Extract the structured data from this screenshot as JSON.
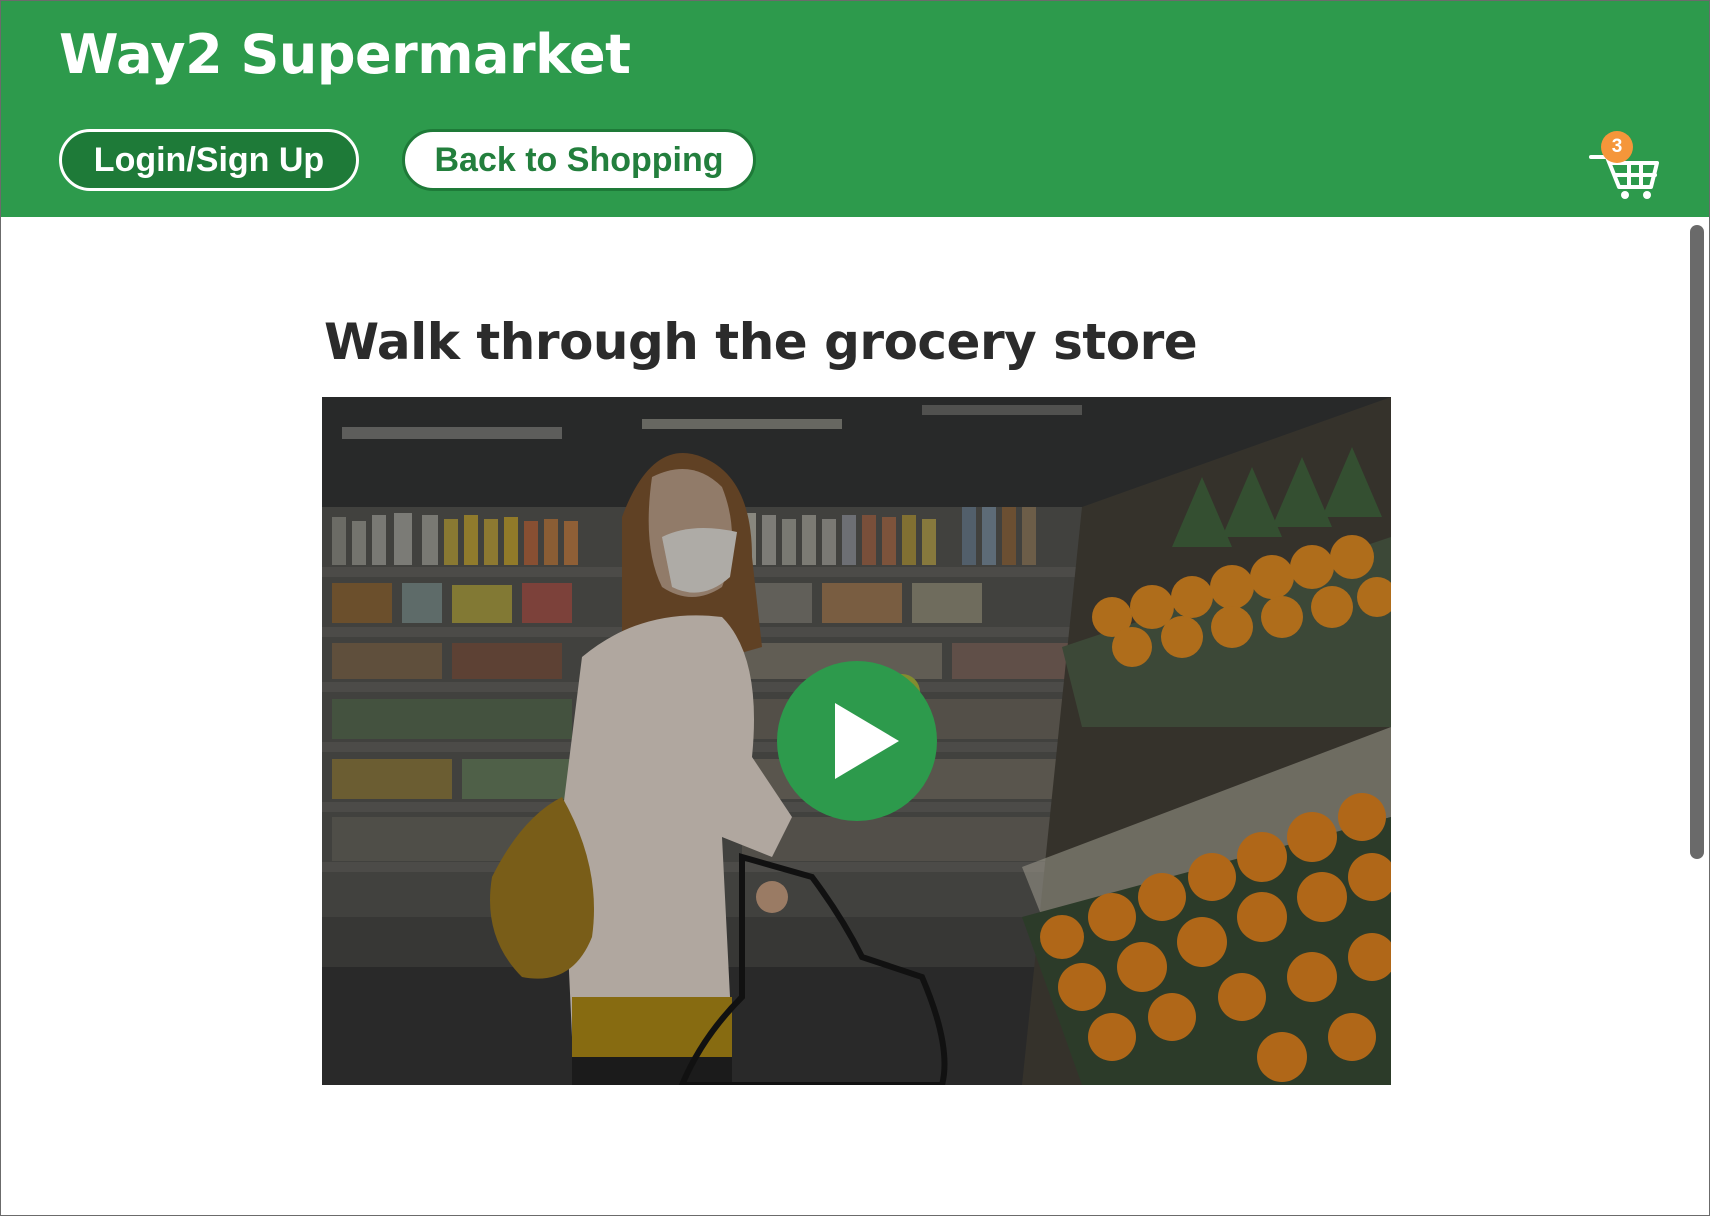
{
  "header": {
    "brand": "Way2 Supermarket",
    "login_label": "Login/Sign Up",
    "back_label": "Back to Shopping",
    "cart_count": "3"
  },
  "main": {
    "title": "Walk through the grocery store",
    "video": {
      "alt": "Woman wearing a face mask shopping for fruit in a grocery store",
      "play_icon": "play-icon"
    }
  },
  "colors": {
    "header_bg": "#2d9a4c",
    "button_dark": "#1e7a38",
    "badge": "#f5963a",
    "title_text": "#2b2b2b"
  }
}
